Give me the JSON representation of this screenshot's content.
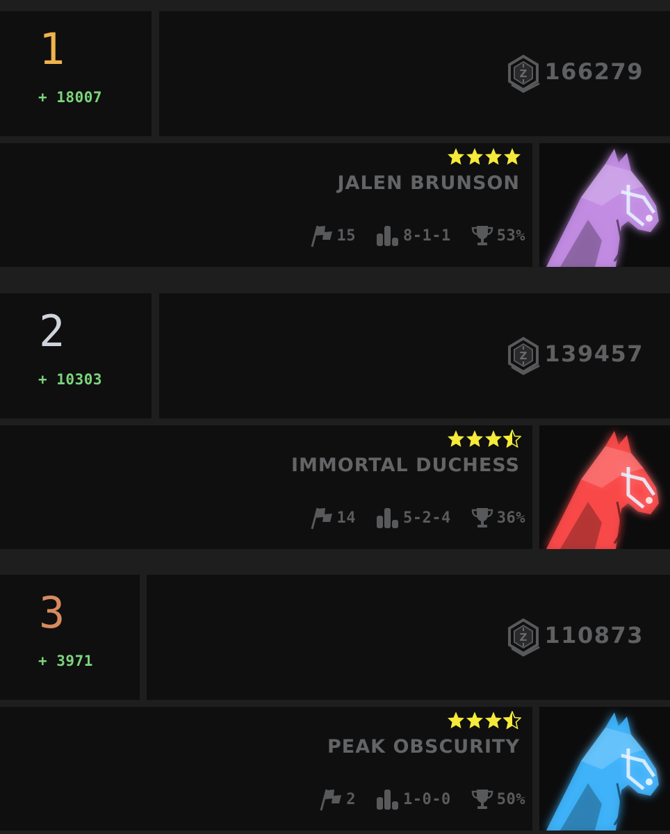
{
  "colors": {
    "background": "#1e1e1f",
    "panel": "#0f0f10",
    "gain": "#7bd67b",
    "muted_text": "#5f6062",
    "star": "#f5ea3a"
  },
  "entries": [
    {
      "rank": "1",
      "rank_color": "#f0b34a",
      "gain": "+ 18007",
      "score": "166279",
      "coin_icon": "zed-coin-icon",
      "horse": {
        "rating_stars": 4,
        "name": "JALEN BRUNSON",
        "color": "#c58ee8",
        "races": "15",
        "placings": "8-1-1",
        "win_rate": "53%"
      }
    },
    {
      "rank": "2",
      "rank_color": "#cfd3dc",
      "gain": "+ 10303",
      "score": "139457",
      "coin_icon": "zed-coin-icon",
      "horse": {
        "rating_stars": 3.5,
        "name": "IMMORTAL DUCHESS",
        "color": "#ff4a4a",
        "races": "14",
        "placings": "5-2-4",
        "win_rate": "36%"
      }
    },
    {
      "rank": "3",
      "rank_color": "#d88a5e",
      "gain": "+ 3971",
      "score": "110873",
      "coin_icon": "zed-coin-icon",
      "horse": {
        "rating_stars": 3.5,
        "name": "PEAK OBSCURITY",
        "color": "#3fb6ff",
        "races": "2",
        "placings": "1-0-0",
        "win_rate": "50%"
      }
    }
  ],
  "icons": {
    "races": "flag-icon",
    "placings": "podium-icon",
    "win_rate": "trophy-icon"
  }
}
